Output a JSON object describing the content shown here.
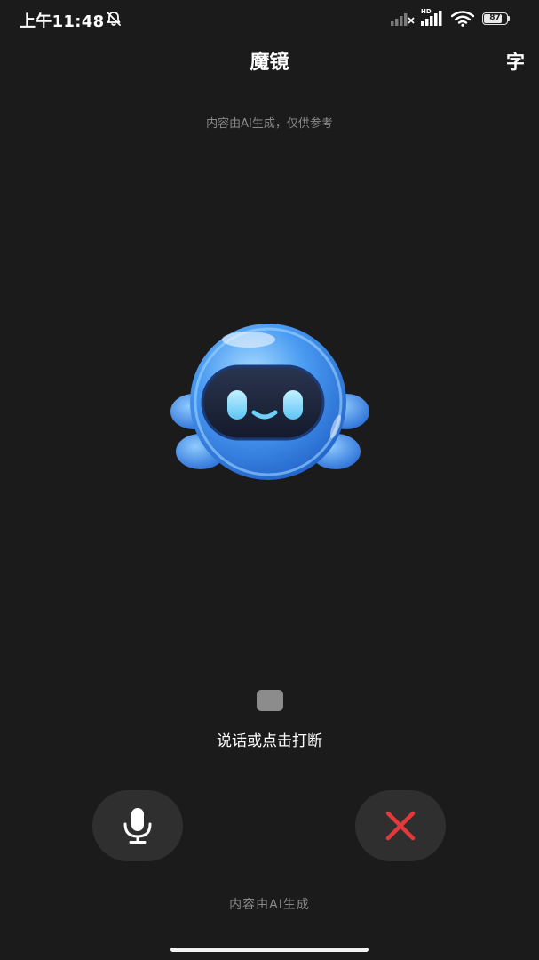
{
  "status_bar": {
    "time": "上午11:48",
    "battery": "87",
    "battery_level": 0.87,
    "network_label": "HD",
    "icons": [
      "bell-off-icon",
      "signal-icon",
      "signal-hd-icon",
      "wifi-icon",
      "battery-icon"
    ]
  },
  "header": {
    "title": "魔镜",
    "subtitle_toggle": "字"
  },
  "disclaimer_top": "内容由AI生成，仅供参考",
  "main": {
    "avatar_icon": "robot-avatar-icon",
    "stop_icon": "stop-icon",
    "status_text": "说话或点击打断"
  },
  "controls": {
    "mic_icon": "microphone-icon",
    "hangup_icon": "close-icon",
    "hangup_color": "#e5383b"
  },
  "footer": "内容由AI生成",
  "colors": {
    "background": "#1b1b1b",
    "button_bg": "#2f2f2f",
    "muted_text": "#8a8a8a",
    "avatar_blue": "#3b8cf0"
  }
}
